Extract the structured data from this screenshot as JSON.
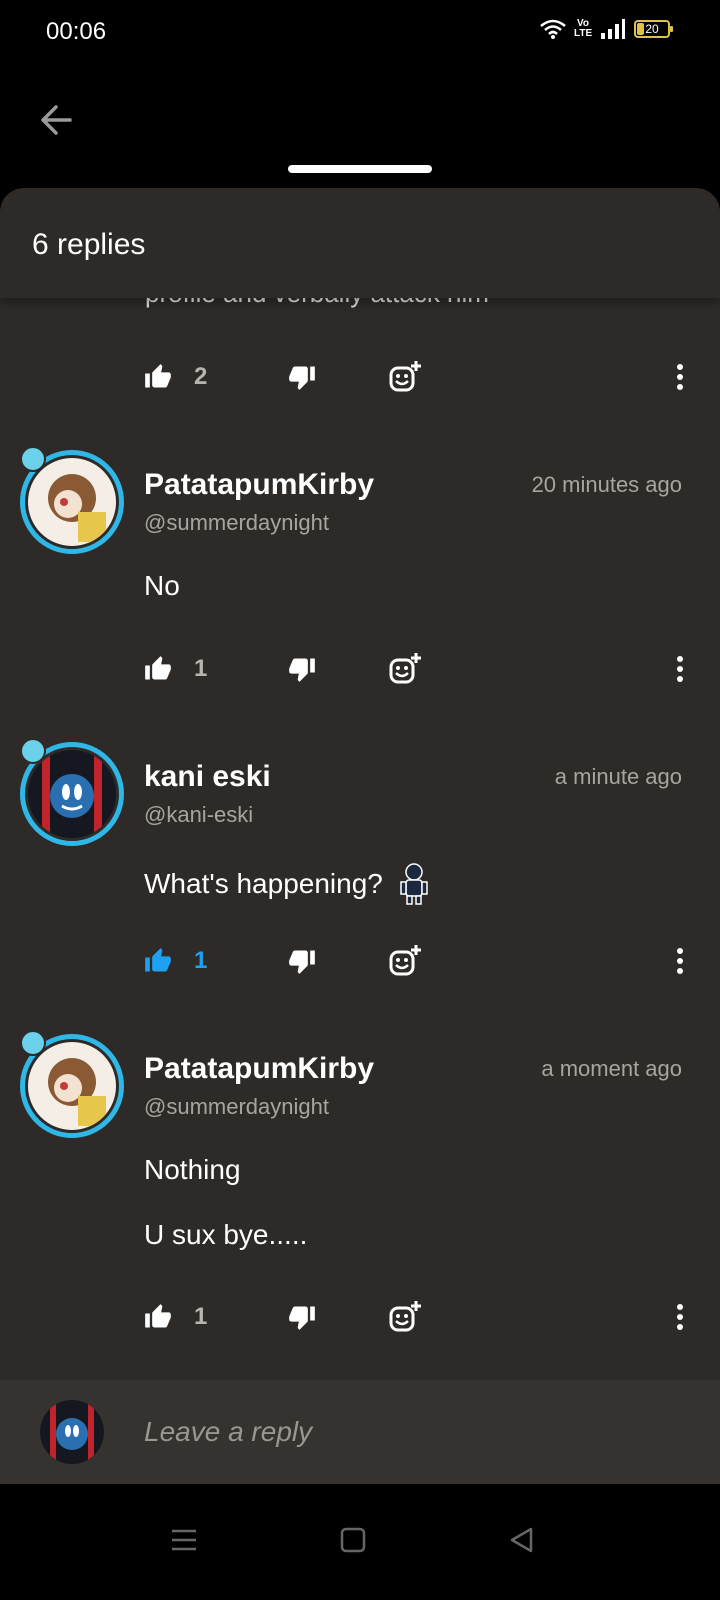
{
  "status_bar": {
    "time": "00:06",
    "network_label": "Vo LTE",
    "battery_level": "20"
  },
  "sheet": {
    "title": "6 replies",
    "partial_text": "profile and verbally attack him"
  },
  "top_actions": {
    "likes": "2"
  },
  "comments": [
    {
      "username": "PatatapumKirby",
      "handle": "@summerdaynight",
      "timestamp": "20 minutes ago",
      "text": "No",
      "likes": "1",
      "liked": false
    },
    {
      "username": "kani eski",
      "handle": "@kani-eski",
      "timestamp": "a minute ago",
      "text": "What's happening?",
      "likes": "1",
      "liked": true
    },
    {
      "username": "PatatapumKirby",
      "handle": "@summerdaynight",
      "timestamp": "a moment ago",
      "text_lines": [
        "Nothing",
        "U sux bye....."
      ],
      "likes": "1",
      "liked": false
    }
  ],
  "reply": {
    "placeholder": "Leave a reply"
  },
  "colors": {
    "accent": "#1da1f2",
    "ring": "#2fb7e8",
    "sheet": "#2d2a28"
  },
  "icons": [
    "back-arrow-icon",
    "thumbs-up-icon",
    "thumbs-down-icon",
    "add-reaction-icon",
    "more-vert-icon",
    "menu-icon",
    "home-icon",
    "back-triangle-icon"
  ]
}
